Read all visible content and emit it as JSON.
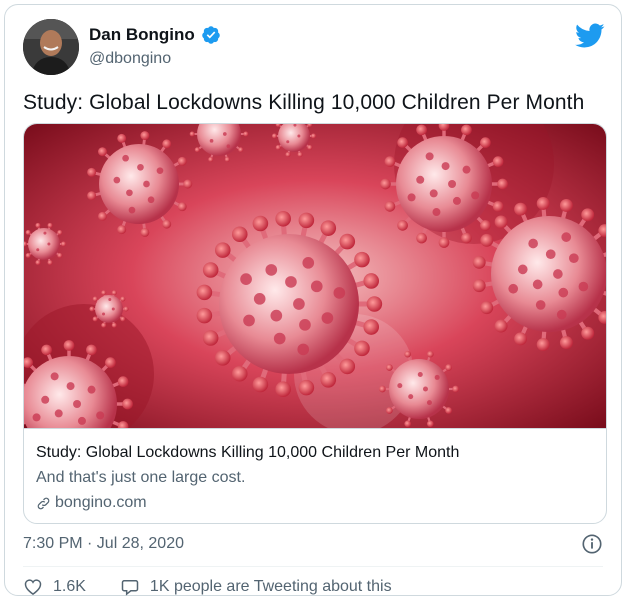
{
  "author": {
    "display_name": "Dan Bongino",
    "handle": "@dbongino",
    "verified": true,
    "avatar_icon": "profile-photo"
  },
  "brand": {
    "icon": "twitter-bird-icon",
    "color": "#1d9bf0"
  },
  "tweet": {
    "text": "Study: Global Lockdowns Killing 10,000 Children Per Month",
    "timestamp": "7:30 PM · Jul 28, 2020"
  },
  "card": {
    "title": "Study: Global Lockdowns Killing 10,000 Children Per Month",
    "description": "And that's just one large cost.",
    "domain": "bongino.com",
    "image_subject": "red coronavirus particles"
  },
  "actions": {
    "likes": "1.6K",
    "conversation": "1K people are Tweeting about this"
  },
  "colors": {
    "text": "#0f1419",
    "secondary": "#536471",
    "border": "#cfd9de",
    "accent": "#1d9bf0"
  }
}
